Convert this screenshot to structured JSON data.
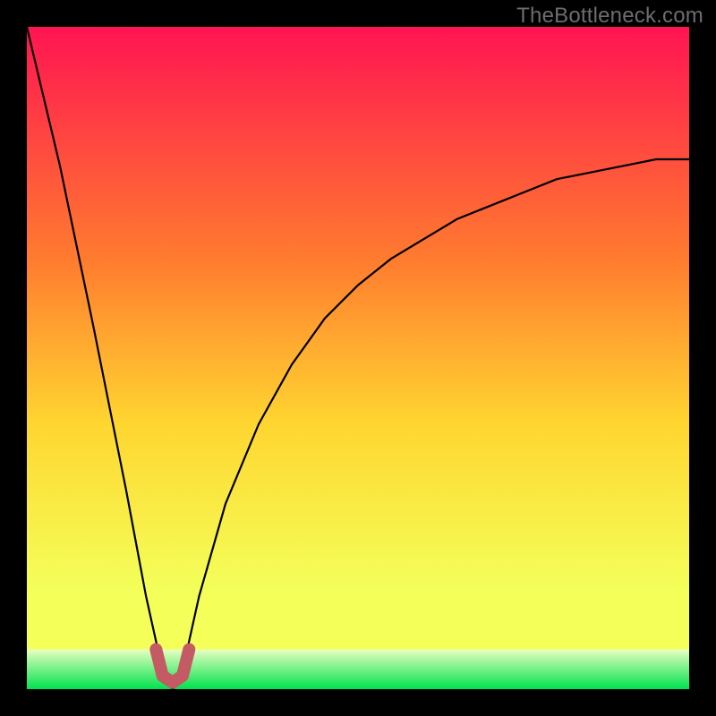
{
  "watermark": "TheBottleneck.com",
  "chart_data": {
    "type": "line",
    "title": "",
    "xlabel": "",
    "ylabel": "",
    "xlim": [
      0,
      100
    ],
    "ylim": [
      0,
      100
    ],
    "background_gradient": {
      "top": "#ff1452",
      "mid_upper": "#ff7b2f",
      "mid": "#ffd630",
      "mid_lower": "#f4ff5a",
      "green_band": "#00e24e"
    },
    "curve": {
      "description": "V-shaped curve dipping to y≈0 near x≈22 then rising asymptotically toward ~80 on the right",
      "x": [
        0,
        5,
        10,
        15,
        18,
        20,
        21,
        22,
        23,
        24,
        26,
        30,
        35,
        40,
        45,
        50,
        55,
        60,
        65,
        70,
        75,
        80,
        85,
        90,
        95,
        100
      ],
      "y": [
        100,
        79,
        55,
        30,
        14,
        5,
        1,
        0,
        1,
        5,
        14,
        28,
        40,
        49,
        56,
        61,
        65,
        68,
        71,
        73,
        75,
        77,
        78,
        79,
        80,
        80
      ]
    },
    "marker_band": {
      "description": "short U-shaped marker at the curve minimum",
      "points": [
        {
          "x": 19.5,
          "y": 6
        },
        {
          "x": 20.5,
          "y": 2
        },
        {
          "x": 22.0,
          "y": 1
        },
        {
          "x": 23.5,
          "y": 2
        },
        {
          "x": 24.5,
          "y": 6
        }
      ],
      "color": "#c45a63",
      "stroke_width_px": 14
    }
  }
}
